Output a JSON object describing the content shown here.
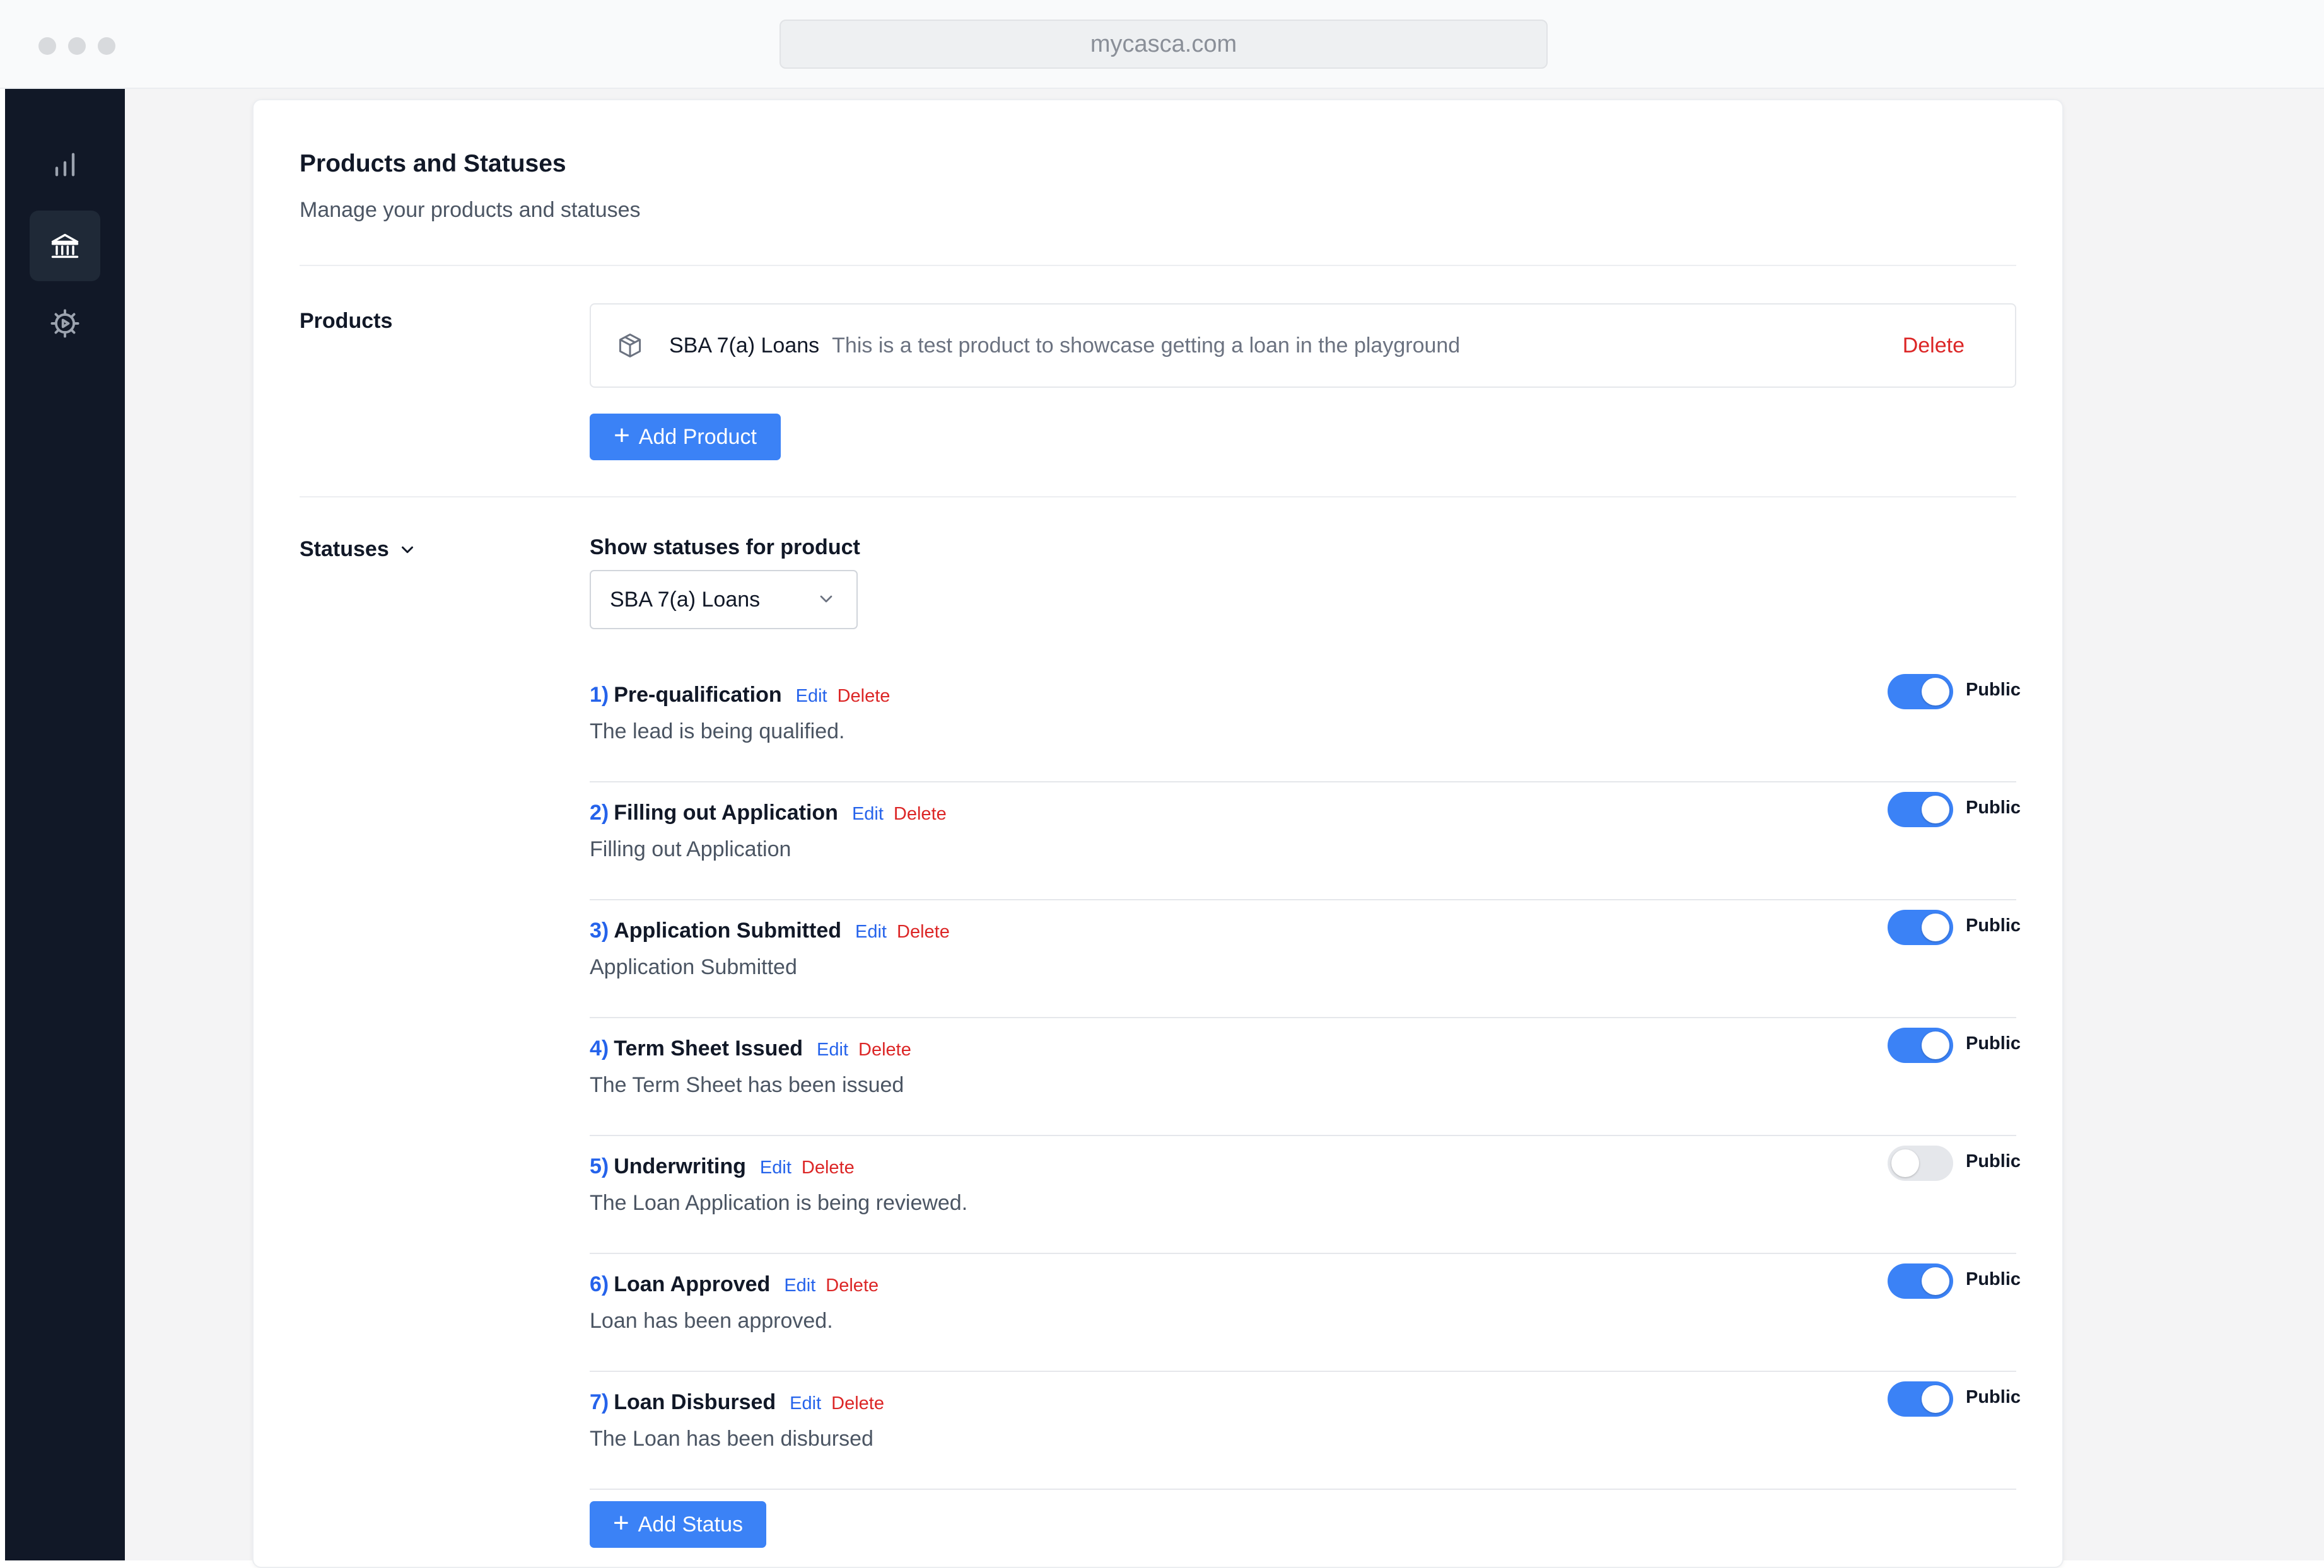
{
  "browser": {
    "url": "mycasca.com"
  },
  "sidebar": {
    "items": [
      {
        "icon": "bar-chart-icon",
        "active": false
      },
      {
        "icon": "bank-icon",
        "active": true
      },
      {
        "icon": "settings-icon",
        "active": false
      }
    ]
  },
  "page": {
    "title": "Products and Statuses",
    "subtitle": "Manage your products and statuses"
  },
  "products": {
    "label": "Products",
    "items": [
      {
        "name": "SBA 7(a) Loans",
        "description": "This is a test product to showcase getting a loan in the playground",
        "delete_label": "Delete"
      }
    ],
    "add_label": "Add Product"
  },
  "statuses": {
    "label": "Statuses",
    "filter_label": "Show statuses for product",
    "selected_product": "SBA 7(a) Loans",
    "edit_label": "Edit",
    "delete_label": "Delete",
    "public_label": "Public",
    "items": [
      {
        "num": "1)",
        "name": "Pre-qualification",
        "desc": "The lead is being qualified.",
        "public": true
      },
      {
        "num": "2)",
        "name": "Filling out Application",
        "desc": "Filling out Application",
        "public": true
      },
      {
        "num": "3)",
        "name": "Application Submitted",
        "desc": "Application Submitted",
        "public": true
      },
      {
        "num": "4)",
        "name": "Term Sheet Issued",
        "desc": "The Term Sheet has been issued",
        "public": true
      },
      {
        "num": "5)",
        "name": "Underwriting",
        "desc": "The Loan Application is being reviewed.",
        "public": false
      },
      {
        "num": "6)",
        "name": "Loan Approved",
        "desc": "Loan has been approved.",
        "public": true
      },
      {
        "num": "7)",
        "name": "Loan Disbursed",
        "desc": "The Loan has been disbursed",
        "public": true
      }
    ],
    "add_label": "Add Status"
  },
  "colors": {
    "accent": "#3b82f6",
    "link": "#2563eb",
    "danger": "#dc2626",
    "sidebar": "#111827"
  }
}
